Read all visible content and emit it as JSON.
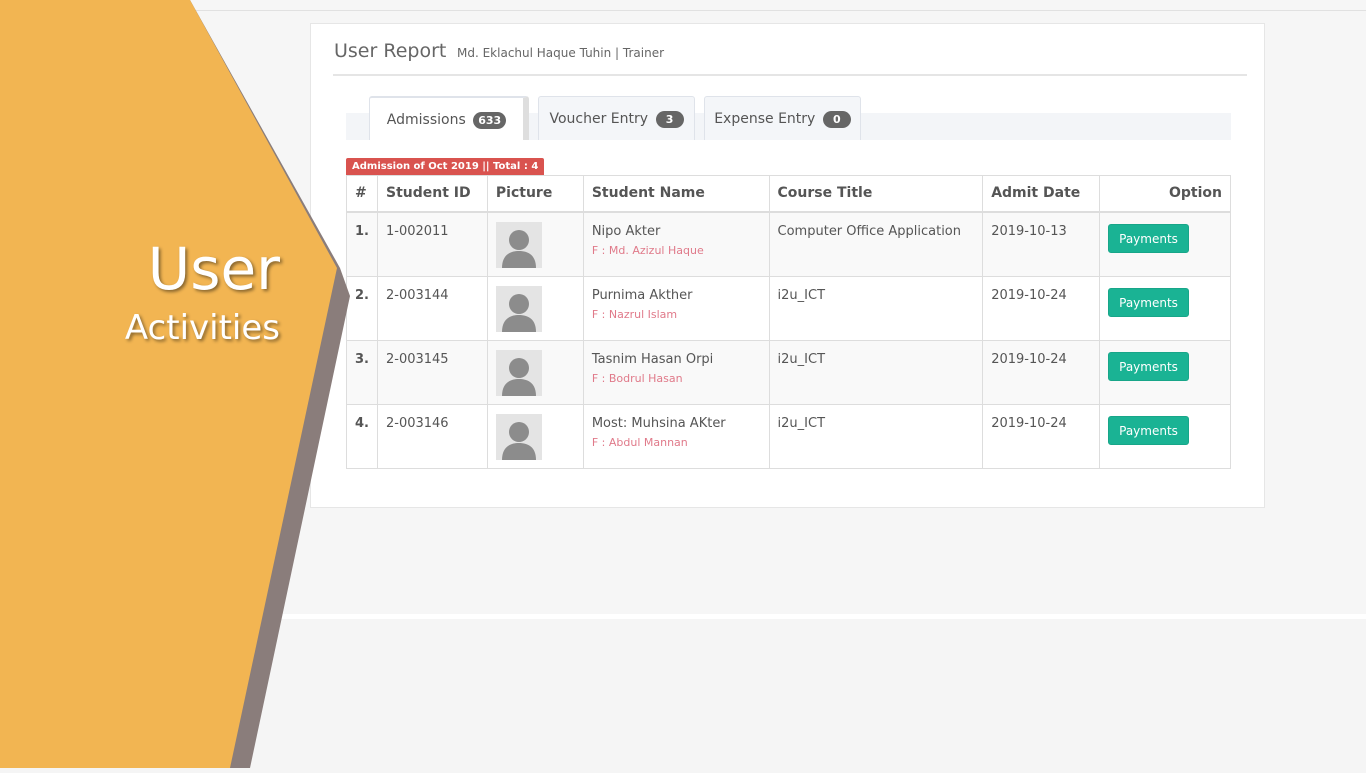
{
  "banner": {
    "title": "User",
    "subtitle": "Activities",
    "colors": {
      "orange": "#f2b552",
      "shadow": "#8a7d7b"
    }
  },
  "report": {
    "title": "User Report",
    "subtitle": "Md. Eklachul Haque Tuhin | Trainer"
  },
  "tabs": [
    {
      "label": "Admissions",
      "count": "633",
      "active": true
    },
    {
      "label": "Voucher Entry",
      "count": "3",
      "active": false
    },
    {
      "label": "Expense Entry",
      "count": "0",
      "active": false
    }
  ],
  "total_label": "Admission of Oct 2019 || Total : 4",
  "table": {
    "headers": {
      "index": "#",
      "student_id": "Student ID",
      "picture": "Picture",
      "student_name": "Student Name",
      "course_title": "Course Title",
      "admit_date": "Admit Date",
      "option": "Option"
    },
    "rows": [
      {
        "index": "1.",
        "student_id": "1-002011",
        "name": "Nipo Akter",
        "father": "F : Md. Azizul Haque",
        "course": "Computer Office Application",
        "date": "2019-10-13",
        "action": "Payments"
      },
      {
        "index": "2.",
        "student_id": "2-003144",
        "name": "Purnima Akther",
        "father": "F : Nazrul Islam",
        "course": "i2u_ICT",
        "date": "2019-10-24",
        "action": "Payments"
      },
      {
        "index": "3.",
        "student_id": "2-003145",
        "name": "Tasnim Hasan Orpi",
        "father": "F : Bodrul Hasan",
        "course": "i2u_ICT",
        "date": "2019-10-24",
        "action": "Payments"
      },
      {
        "index": "4.",
        "student_id": "2-003146",
        "name": "Most: Muhsina AKter",
        "father": "F : Abdul Mannan",
        "course": "i2u_ICT",
        "date": "2019-10-24",
        "action": "Payments"
      }
    ]
  },
  "colors": {
    "accent_button": "#1ab394",
    "label_red": "#d9534f",
    "father_text": "#e07a8a"
  }
}
